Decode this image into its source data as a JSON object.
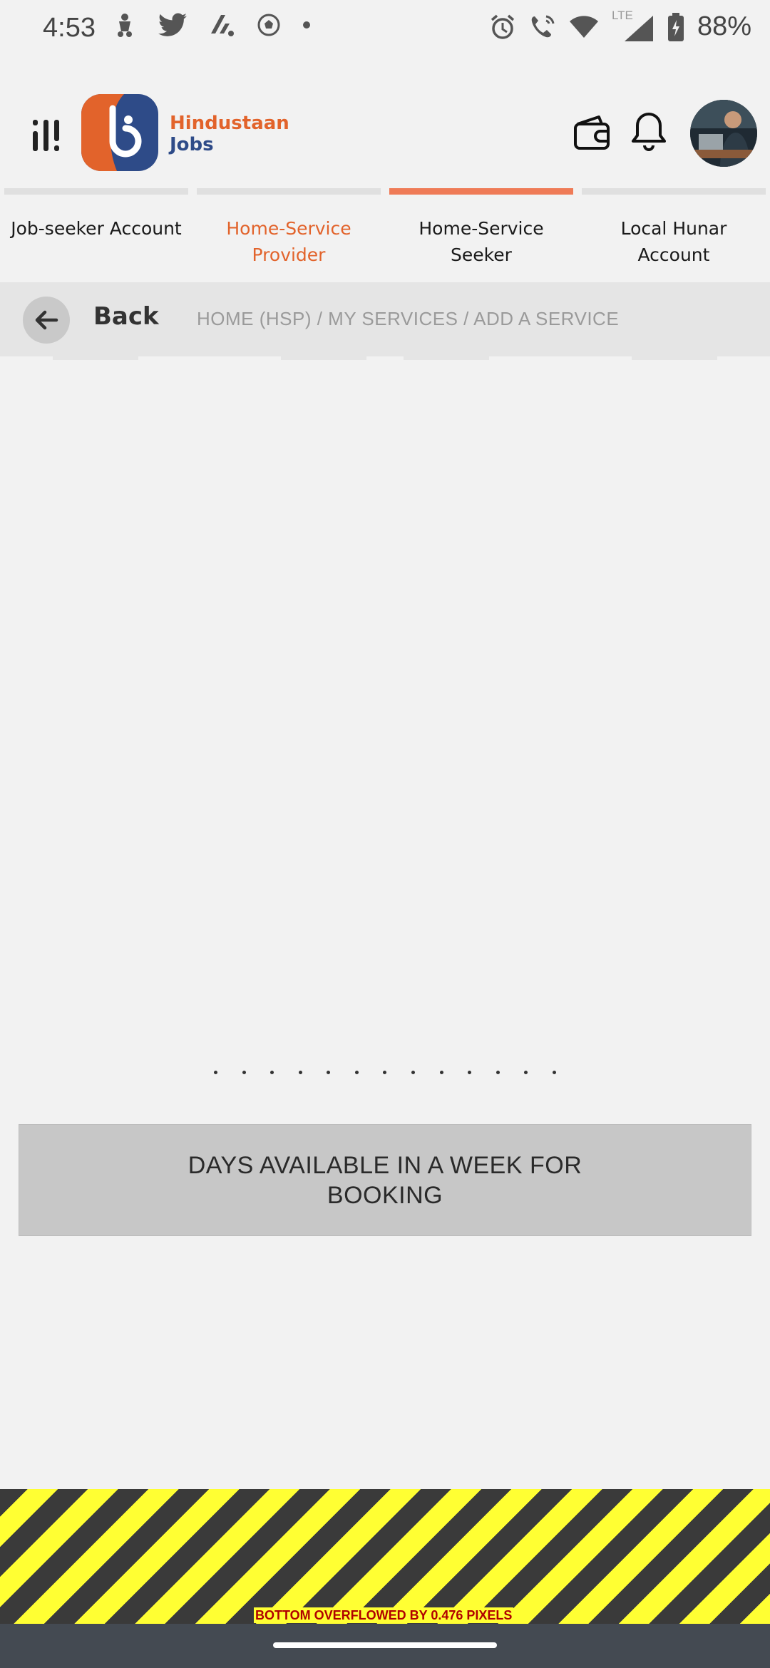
{
  "status_bar": {
    "time": "4:53",
    "battery": "88%",
    "network": "LTE",
    "left_icons": [
      "scooter-icon",
      "twitter-icon",
      "app-icon",
      "soccer-icon",
      "dot-icon"
    ],
    "right_icons": [
      "alarm-icon",
      "wifi-call-icon",
      "wifi-icon",
      "signal-icon",
      "battery-icon"
    ]
  },
  "header": {
    "logo_line1": "Hindustaan",
    "logo_line2": "Jobs",
    "logo_colors": {
      "orange": "#e2632b",
      "navy": "#2e4b88"
    }
  },
  "tabs": [
    {
      "label": "Job-seeker Account",
      "active": false,
      "highlighted": false
    },
    {
      "label": "Home-Service Provider",
      "active": false,
      "highlighted": true
    },
    {
      "label": "Home-Service Seeker",
      "active": true,
      "highlighted": false
    },
    {
      "label": "Local Hunar Account",
      "active": false,
      "highlighted": false
    }
  ],
  "breadcrumb_bar": {
    "back_label": "Back",
    "path": "HOME (HSP) / MY SERVICES / ADD A SERVICE"
  },
  "days_section": {
    "heading": "DAYS AVAILABLE IN A WEEK FOR BOOKING"
  },
  "debug_overlay": {
    "message": "BOTTOM OVERFLOWED BY 0.476 PIXELS"
  }
}
